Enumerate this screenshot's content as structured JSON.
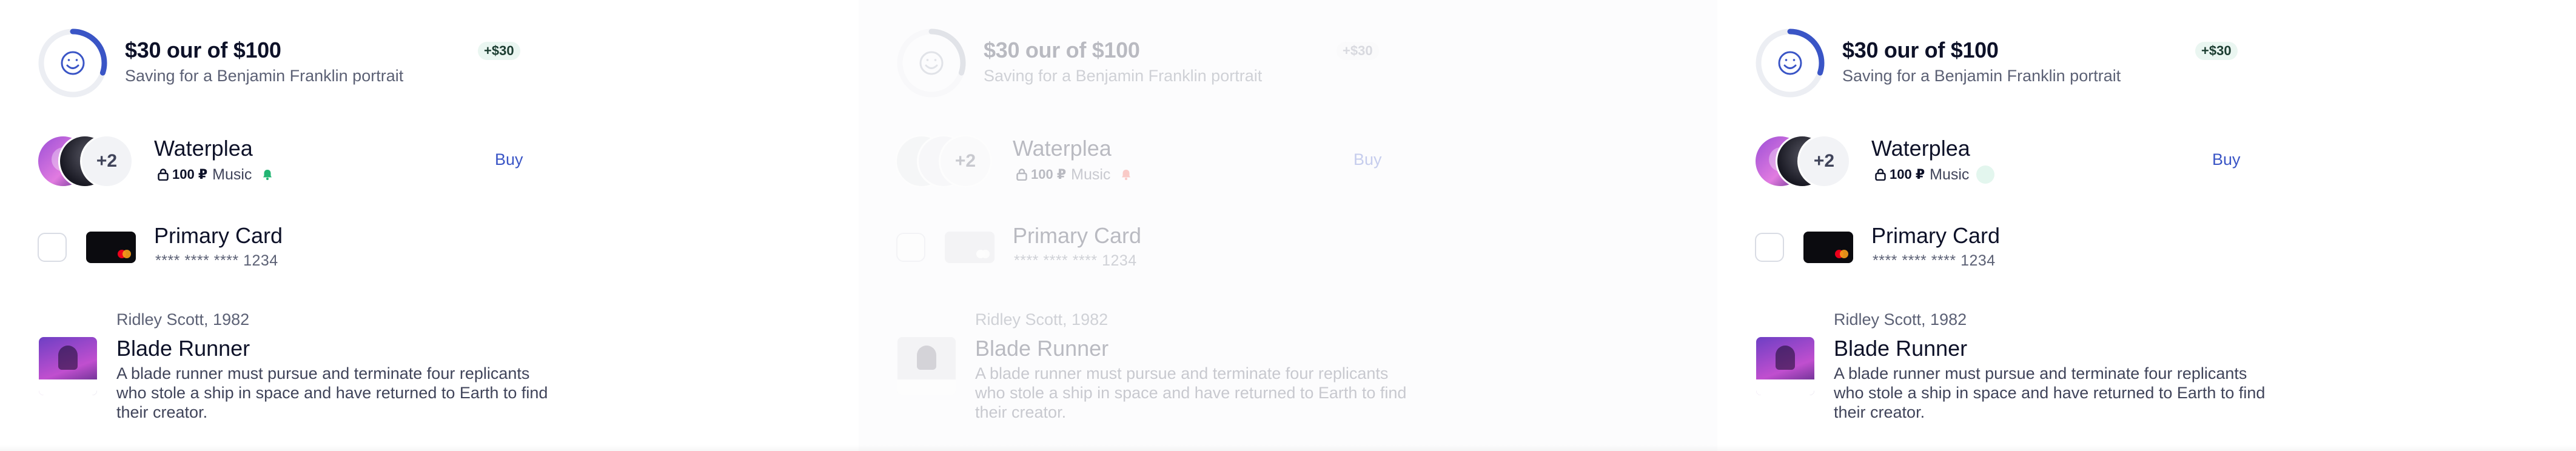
{
  "colors": {
    "accent": "#3a55c6",
    "ring_track": "#eceef3",
    "badge_bg": "#eaf6f1",
    "success_bell": "#22b573",
    "alert_bell": "#f0483e",
    "mastercard_red": "#eb001b",
    "mastercard_orange": "#f79e1b"
  },
  "progress": {
    "value": 30,
    "target": 100,
    "fraction": 0.3,
    "title": "$30 our of $100",
    "subtitle": "Saving for a Benjamin Franklin portrait",
    "badge": "+$30",
    "icon": "smiley-face-icon"
  },
  "purchase": {
    "title": "Waterplea",
    "price": "100 ₽",
    "category": "Music",
    "extra_count": "+2",
    "buy_label": "Buy",
    "icons": [
      "lock-icon",
      "bell-icon"
    ]
  },
  "card": {
    "title": "Primary Card",
    "number": "**** **** **** 1234",
    "brand_icon": "mastercard-icon"
  },
  "movie": {
    "director": "Ridley Scott, 1982",
    "title": "Blade Runner",
    "description": "A blade runner must pursue and terminate four replicants who stole a ship in space and have returned to Earth to find their creator."
  },
  "panels": [
    {
      "state": "default",
      "bell_color": "#22b573"
    },
    {
      "state": "disabled",
      "bell_color": "#f0483e"
    },
    {
      "state": "default",
      "bell_color": "#d8f3e7"
    }
  ]
}
